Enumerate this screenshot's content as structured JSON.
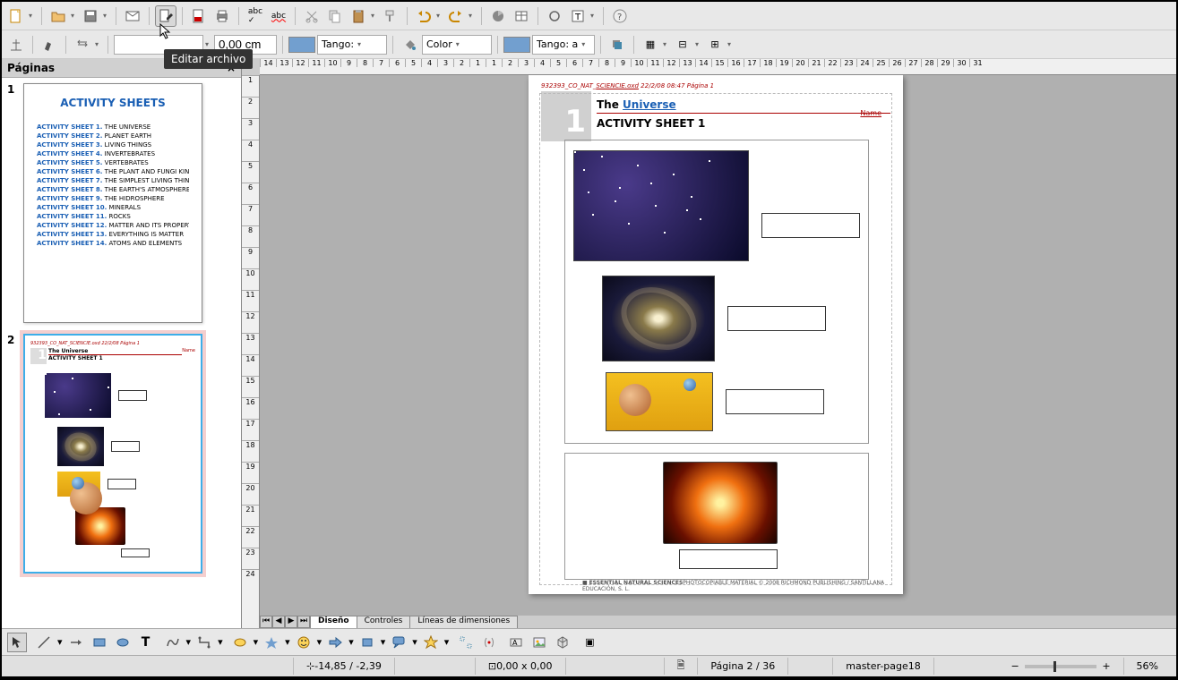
{
  "tooltip": "Editar archivo",
  "sidebar": {
    "title": "Páginas",
    "pages": [
      {
        "num": "1",
        "heading": "ACTIVITY SHEETS",
        "lines": [
          {
            "lbl": "ACTIVITY SHEET 1.",
            "txt": " THE UNIVERSE"
          },
          {
            "lbl": "ACTIVITY SHEET 2.",
            "txt": " PLANET EARTH"
          },
          {
            "lbl": "ACTIVITY SHEET 3.",
            "txt": " LIVING THINGS"
          },
          {
            "lbl": "ACTIVITY SHEET 4.",
            "txt": " INVERTEBRATES"
          },
          {
            "lbl": "ACTIVITY SHEET 5.",
            "txt": " VERTEBRATES"
          },
          {
            "lbl": "ACTIVITY SHEET 6.",
            "txt": " THE PLANT AND FUNGI KINGDOM"
          },
          {
            "lbl": "ACTIVITY SHEET 7.",
            "txt": " THE SIMPLEST LIVING THINGS"
          },
          {
            "lbl": "ACTIVITY SHEET 8.",
            "txt": " THE EARTH'S ATMOSPHERE"
          },
          {
            "lbl": "ACTIVITY SHEET 9.",
            "txt": " THE HIDROSPHERE"
          },
          {
            "lbl": "ACTIVITY SHEET 10.",
            "txt": " MINERALS"
          },
          {
            "lbl": "ACTIVITY SHEET 11.",
            "txt": " ROCKS"
          },
          {
            "lbl": "ACTIVITY SHEET 12.",
            "txt": " MATTER AND ITS PROPERTIES"
          },
          {
            "lbl": "ACTIVITY SHEET 13.",
            "txt": " EVERYTHING IS MATTER"
          },
          {
            "lbl": "ACTIVITY SHEET 14.",
            "txt": " ATOMS AND ELEMENTS"
          }
        ]
      },
      {
        "num": "2"
      }
    ]
  },
  "toolbar2": {
    "line_width": "0,00 cm",
    "fill_style_1": "Tango:",
    "fill_label": "Color",
    "fill_style_2": "Tango: a",
    "colors": {
      "stroke": "#729fcf",
      "fill": "#729fcf"
    }
  },
  "ruler_h": [
    "1",
    "2",
    "3",
    "4",
    "5",
    "6",
    "7",
    "8",
    "9",
    "10",
    "11",
    "12",
    "13",
    "14",
    "15",
    "16",
    "17",
    "18",
    "19",
    "20",
    "21",
    "22",
    "23",
    "24",
    "25",
    "26",
    "27",
    "28",
    "29",
    "30",
    "31"
  ],
  "ruler_h_right": [
    "1",
    "2",
    "3",
    "4",
    "5",
    "6",
    "7",
    "8",
    "9",
    "10",
    "11",
    "12",
    "13",
    "14",
    "15",
    "16",
    "17",
    "18",
    "19",
    "20",
    "21",
    "22",
    "23",
    "24",
    "25",
    "26",
    "27",
    "28",
    "29",
    "30",
    "31"
  ],
  "ruler_v": [
    "1",
    "2",
    "3",
    "4",
    "5",
    "6",
    "7",
    "8",
    "9",
    "10",
    "11",
    "12",
    "13",
    "14",
    "15",
    "16",
    "17",
    "18",
    "19",
    "20",
    "21",
    "22",
    "23",
    "24"
  ],
  "page": {
    "header": {
      "prefix": "932393_CO_NAT_",
      "und": "SCIENCIE.oxd",
      "suffix": "  22/2/08  08:47  Página 1"
    },
    "title_num": "1",
    "title_line1_a": "The ",
    "title_line1_b": "Universe",
    "title_line2": "ACTIVITY SHEET 1",
    "name_label": "Name",
    "footer_b": "ESSENTIAL NATURAL SCIENCES",
    "footer_r": "PHOTOCOPIABLE MATERIAL © 2008 RICHMOND PUBLISHING / SANTILLANA EDUCACIÓN, S. L."
  },
  "tabs": {
    "t1": "Diseño",
    "t2": "Controles",
    "t3": "Líneas de dimensiones"
  },
  "status": {
    "coords": "-14,85 / -2,39",
    "size": "0,00 x 0,00",
    "page": "Página 2 / 36",
    "master": "master-page18",
    "zoom": "56%"
  }
}
